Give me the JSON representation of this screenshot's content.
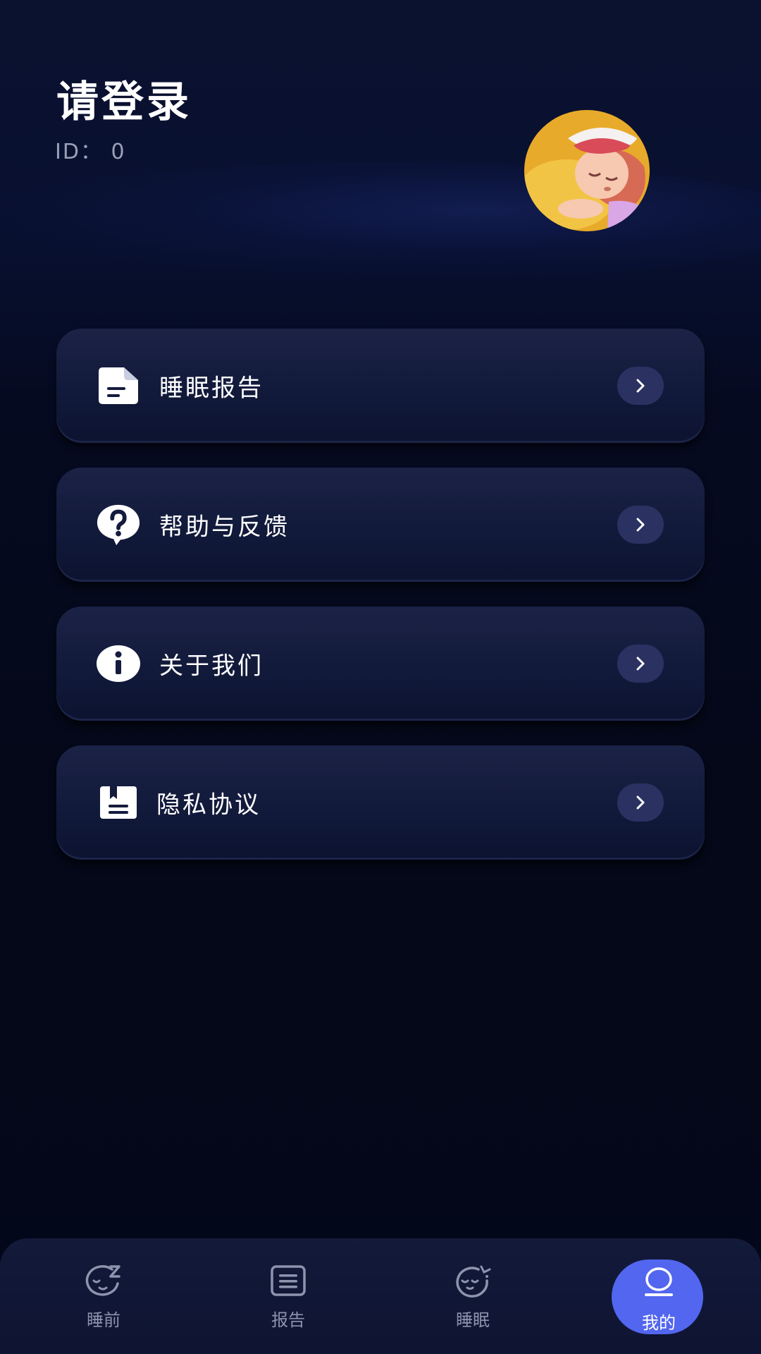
{
  "header": {
    "title": "请登录",
    "id_label": "ID：  0"
  },
  "menu": {
    "items": [
      {
        "label": "睡眠报告",
        "icon": "document-icon"
      },
      {
        "label": "帮助与反馈",
        "icon": "help-bubble-icon"
      },
      {
        "label": "关于我们",
        "icon": "info-icon"
      },
      {
        "label": "隐私协议",
        "icon": "privacy-document-icon"
      }
    ]
  },
  "tabbar": {
    "tabs": [
      {
        "label": "睡前",
        "icon": "sleep-face-icon"
      },
      {
        "label": "报告",
        "icon": "report-icon"
      },
      {
        "label": "睡眠",
        "icon": "sleeping-face-icon"
      },
      {
        "label": "我的",
        "icon": "profile-icon",
        "active": true
      }
    ]
  },
  "colors": {
    "background": "#040818",
    "card": "#141b3d",
    "arrow_bg": "#2b3262",
    "active_tab": "#5366ef"
  }
}
